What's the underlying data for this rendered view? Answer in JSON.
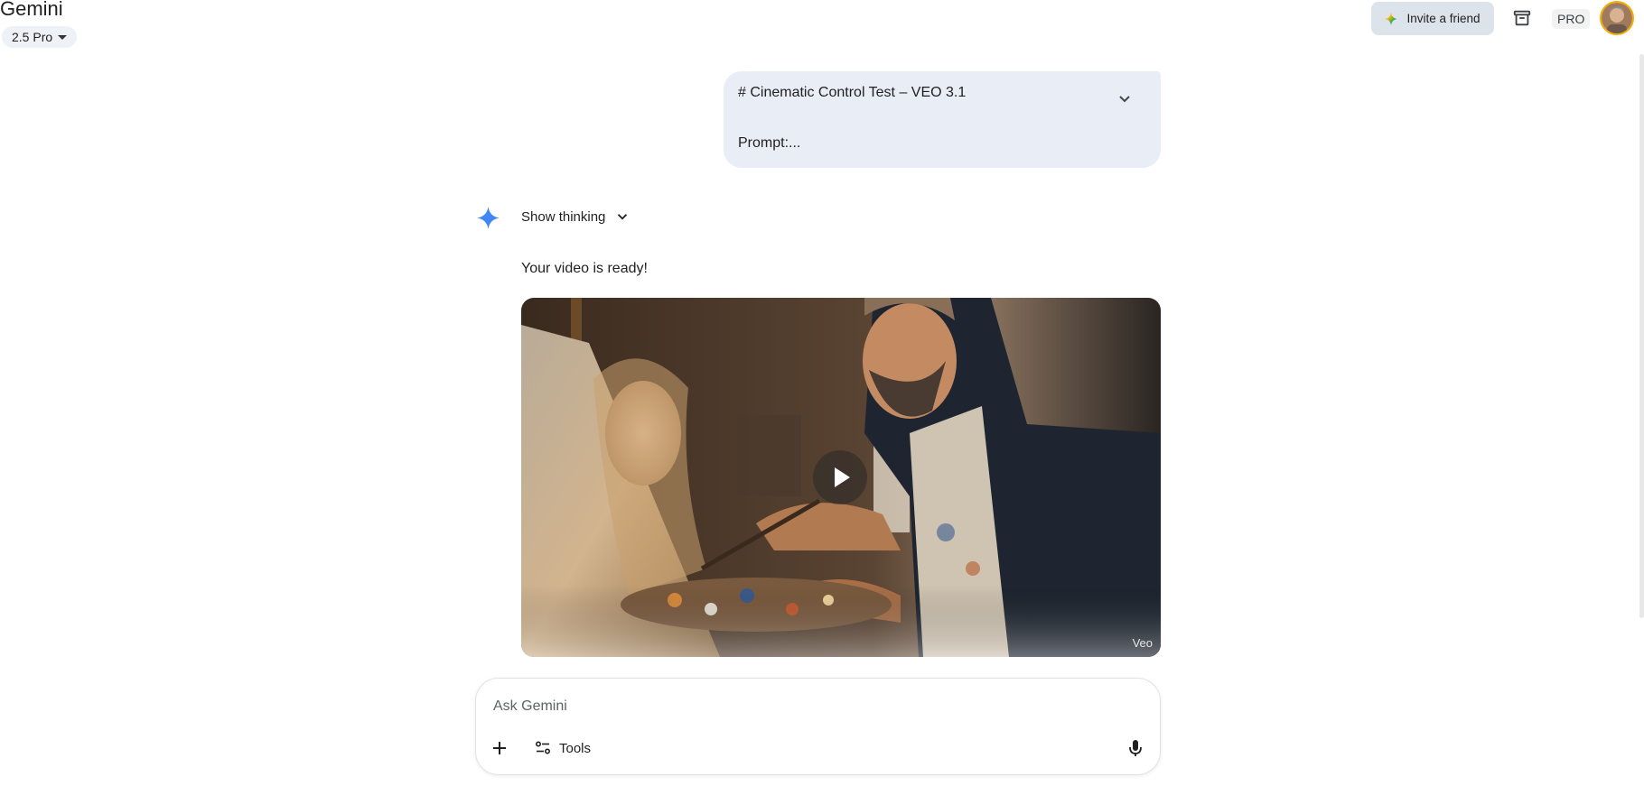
{
  "header": {
    "app_title": "Gemini",
    "model_label": "2.5 Pro",
    "invite_label": "Invite a friend",
    "plan_badge": "PRO"
  },
  "conversation": {
    "user_message": {
      "heading": "# Cinematic Control Test – VEO 3.1",
      "prompt_preview": "Prompt:..."
    },
    "response": {
      "thinking_label": "Show thinking",
      "text": "Your video is ready!",
      "video": {
        "watermark": "Veo",
        "description_icon": "play-icon"
      }
    }
  },
  "composer": {
    "placeholder": "Ask Gemini",
    "tools_label": "Tools"
  },
  "colors": {
    "user_bubble": "#e9eef6",
    "invite_button": "#dde3ea",
    "gemini_spark": "#4285f4",
    "avatar_ring": "#f9ab00"
  }
}
